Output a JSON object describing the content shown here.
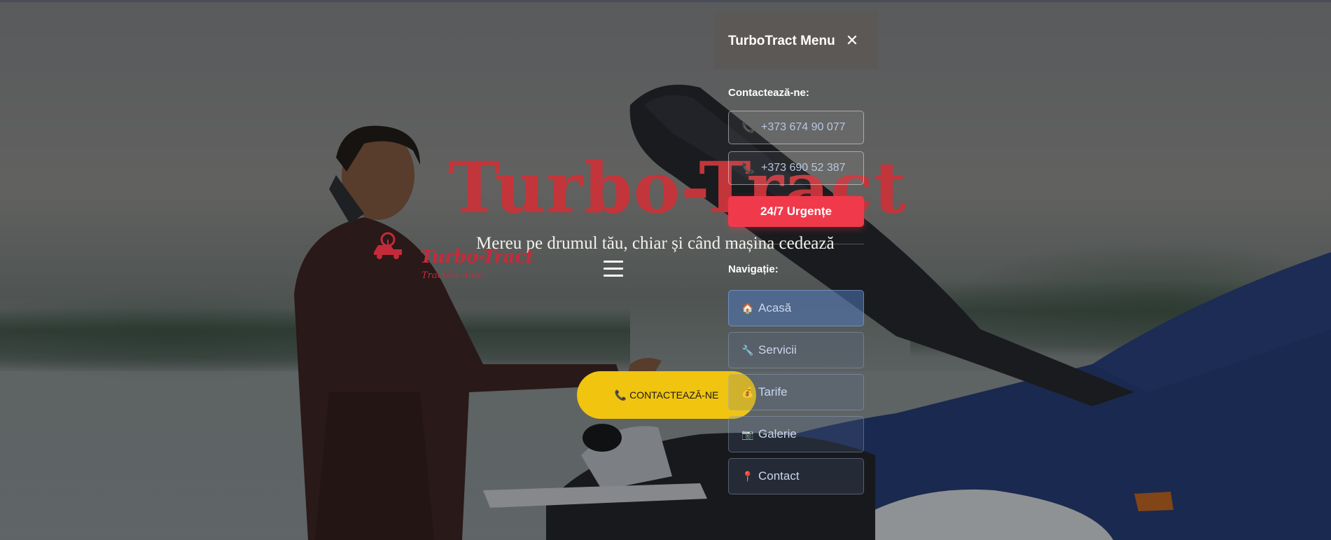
{
  "hero": {
    "title": "Turbo-Tract",
    "subtitle": "Mereu pe drumul tău, chiar și când mașina cedează",
    "cta_icon": "phone-icon",
    "cta_label": "CONTACTEAZĂ-NE"
  },
  "logo": {
    "name": "Turbo-Tract",
    "tagline": "Tractări Auto"
  },
  "menu": {
    "title": "TurboTract Menu",
    "close_icon": "close-icon",
    "contact_label": "Contactează-ne:",
    "phones": [
      {
        "icon": "phone-icon",
        "number": "+373 674 90 077"
      },
      {
        "icon": "phone-icon",
        "number": "+373 690 52 387"
      }
    ],
    "urgent_label": "24/7 Urgențe",
    "nav_label": "Navigație:",
    "nav_items": [
      {
        "icon": "house-icon",
        "label": "Acasă",
        "active": true
      },
      {
        "icon": "wrench-icon",
        "label": "Servicii",
        "active": false
      },
      {
        "icon": "money-bag-icon",
        "label": "Tarife",
        "active": false
      },
      {
        "icon": "camera-icon",
        "label": "Galerie",
        "active": false
      },
      {
        "icon": "pin-icon",
        "label": "Contact",
        "active": false
      }
    ]
  },
  "colors": {
    "title_red": "#c2353a",
    "cta_yellow": "#f0c40f",
    "urgent_red": "#f03a4b",
    "menu_header": "#5b5855",
    "nav_active": "#4f78b9"
  }
}
